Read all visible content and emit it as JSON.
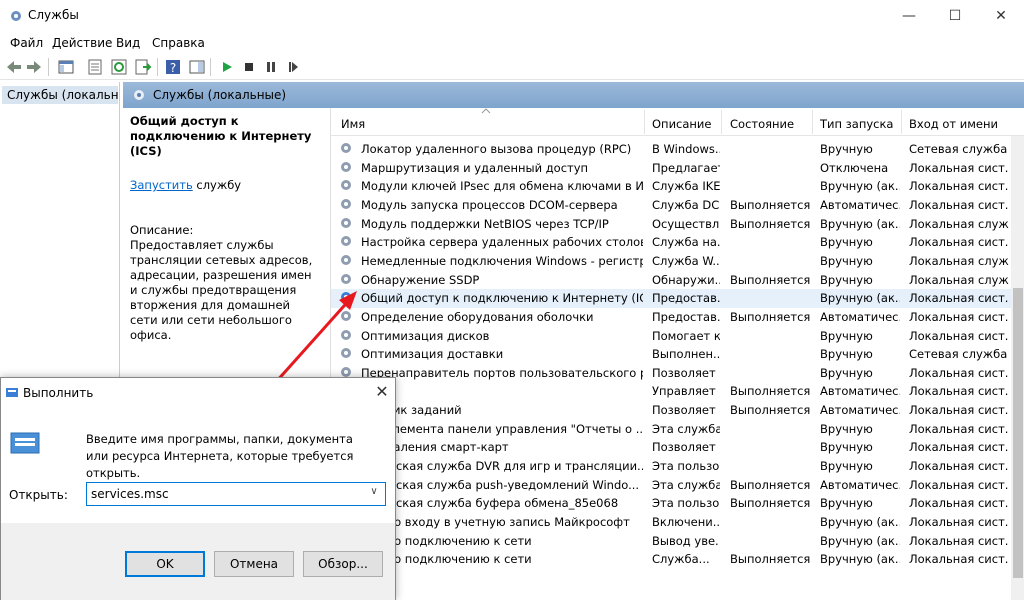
{
  "window": {
    "title": "Службы",
    "minimize_glyph": "—",
    "maximize_glyph": "☐",
    "close_glyph": "✕"
  },
  "menu": [
    "Файл",
    "Действие",
    "Вид",
    "Справка"
  ],
  "toolbar_icons": [
    "back-arrow-icon",
    "forward-arrow-icon",
    "console-tree-icon",
    "properties-icon",
    "refresh-icon",
    "export-list-icon",
    "help-icon",
    "show-hide-icon",
    "start-service-icon",
    "stop-service-icon",
    "pause-service-icon",
    "restart-service-icon"
  ],
  "tree": {
    "item": "Службы (локальн"
  },
  "content": {
    "header": "Службы (локальные)",
    "selected_service": "Общий доступ к подключению к Интернету (ICS)",
    "start_link": "Запустить",
    "start_rest": " службу",
    "description_label": "Описание:",
    "description": "Предоставляет службы трансляции сетевых адресов, адресации, разрешения имен и службы предотвращения вторжения для домашней сети или сети небольшого офиса."
  },
  "columns": {
    "name": "Имя",
    "description": "Описание",
    "status": "Состояние",
    "startup": "Тип запуска",
    "logon": "Вход от имени"
  },
  "rows": [
    {
      "name": "Локатор удаленного вызова процедур (RPC)",
      "desc": "В Windows...",
      "status": "",
      "startup": "Вручную",
      "logon": "Сетевая служба"
    },
    {
      "name": "Маршрутизация и удаленный доступ",
      "desc": "Предлагает...",
      "status": "",
      "startup": "Отключена",
      "logon": "Локальная сист..."
    },
    {
      "name": "Модули ключей IPsec для обмена ключами в Интер...",
      "desc": "Служба IKE...",
      "status": "",
      "startup": "Вручную (ак...",
      "logon": "Локальная сист..."
    },
    {
      "name": "Модуль запуска процессов DCOM-сервера",
      "desc": "Служба DC...",
      "status": "Выполняется",
      "startup": "Автоматичес...",
      "logon": "Локальная сист..."
    },
    {
      "name": "Модуль поддержки NetBIOS через TCP/IP",
      "desc": "Осуществля...",
      "status": "Выполняется",
      "startup": "Вручную (ак...",
      "logon": "Локальная служба"
    },
    {
      "name": "Настройка сервера удаленных рабочих столов",
      "desc": "Служба на...",
      "status": "",
      "startup": "Вручную",
      "logon": "Локальная сист..."
    },
    {
      "name": "Немедленные подключения Windows - регистратор ...",
      "desc": "Служба W...",
      "status": "",
      "startup": "Вручную",
      "logon": "Локальная служба"
    },
    {
      "name": "Обнаружение SSDP",
      "desc": "Обнаружи...",
      "status": "Выполняется",
      "startup": "Вручную",
      "logon": "Локальная служба"
    },
    {
      "name": "Общий доступ к подключению к Интернету (ICS)",
      "desc": "Предостав...",
      "status": "",
      "startup": "Вручную (ак...",
      "logon": "Локальная сист..."
    },
    {
      "name": "Определение оборудования оболочки",
      "desc": "Предостав...",
      "status": "Выполняется",
      "startup": "Автоматичес...",
      "logon": "Локальная сист..."
    },
    {
      "name": "Оптимизация дисков",
      "desc": "Помогает к...",
      "status": "",
      "startup": "Вручную",
      "logon": "Локальная сист..."
    },
    {
      "name": "Оптимизация доставки",
      "desc": "Выполнен...",
      "status": "",
      "startup": "Вручную",
      "logon": "Сетевая служба"
    },
    {
      "name": "Перенаправитель портов пользовательского режим...",
      "desc": "Позволяет ...",
      "status": "",
      "startup": "Вручную",
      "logon": "Локальная сист..."
    },
    {
      "name": "",
      "desc": "Управляет ...",
      "status": "Выполняется",
      "startup": "Автоматичес...",
      "logon": "Локальная сист..."
    },
    {
      "name": "ровщик заданий",
      "desc": "Позволяет ...",
      "status": "Выполняется",
      "startup": "Автоматичес...",
      "logon": "Локальная сист..."
    },
    {
      "name": "нка элемента панели управления \"Отчеты о ...",
      "desc": "Эта служба...",
      "status": "",
      "startup": "Вручную",
      "logon": "Локальная сист..."
    },
    {
      "name": "ка удаления смарт-карт",
      "desc": "Позволяет ...",
      "status": "",
      "startup": "Вручную",
      "logon": "Локальная сист..."
    },
    {
      "name": "ательская служба DVR для игр и трансляции...",
      "desc": "Эта пользо...",
      "status": "",
      "startup": "Вручную",
      "logon": "Локальная сист..."
    },
    {
      "name": "ательская служба push-уведомлений Windo...",
      "desc": "Эта служба...",
      "status": "Выполняется",
      "startup": "Автоматичес...",
      "logon": "Локальная сист..."
    },
    {
      "name": "ательская служба буфера обмена_85e068",
      "desc": "Эта пользо...",
      "status": "Выполняется",
      "startup": "Вручную",
      "logon": "Локальная сист..."
    },
    {
      "name": "ник по входу в учетную запись Майкрософт",
      "desc": "Включени...",
      "status": "",
      "startup": "Вручную (ак...",
      "logon": "Локальная сист..."
    },
    {
      "name": "ник по подключению к сети",
      "desc": "Вывод уве...",
      "status": "",
      "startup": "Вручную (ак...",
      "logon": "Локальная сист..."
    },
    {
      "name": "ник по подключению к сети",
      "desc": "Служба...",
      "status": "Выполняется",
      "startup": "Вручную (ак...",
      "logon": "Локальная сист..."
    }
  ],
  "run_dialog": {
    "title": "Выполнить",
    "close_glyph": "✕",
    "prompt": "Введите имя программы, папки, документа или ресурса Интернета, которые требуется открыть.",
    "open_label": "Открыть:",
    "input_value": "services.msc",
    "dropdown_glyph": "∨",
    "ok": "OK",
    "cancel": "Отмена",
    "browse": "Обзор..."
  },
  "colors": {
    "header_blue": "#7ea4cd",
    "selection": "#d9e4f1",
    "accent": "#0078d7",
    "arrow": "#e8191e"
  }
}
